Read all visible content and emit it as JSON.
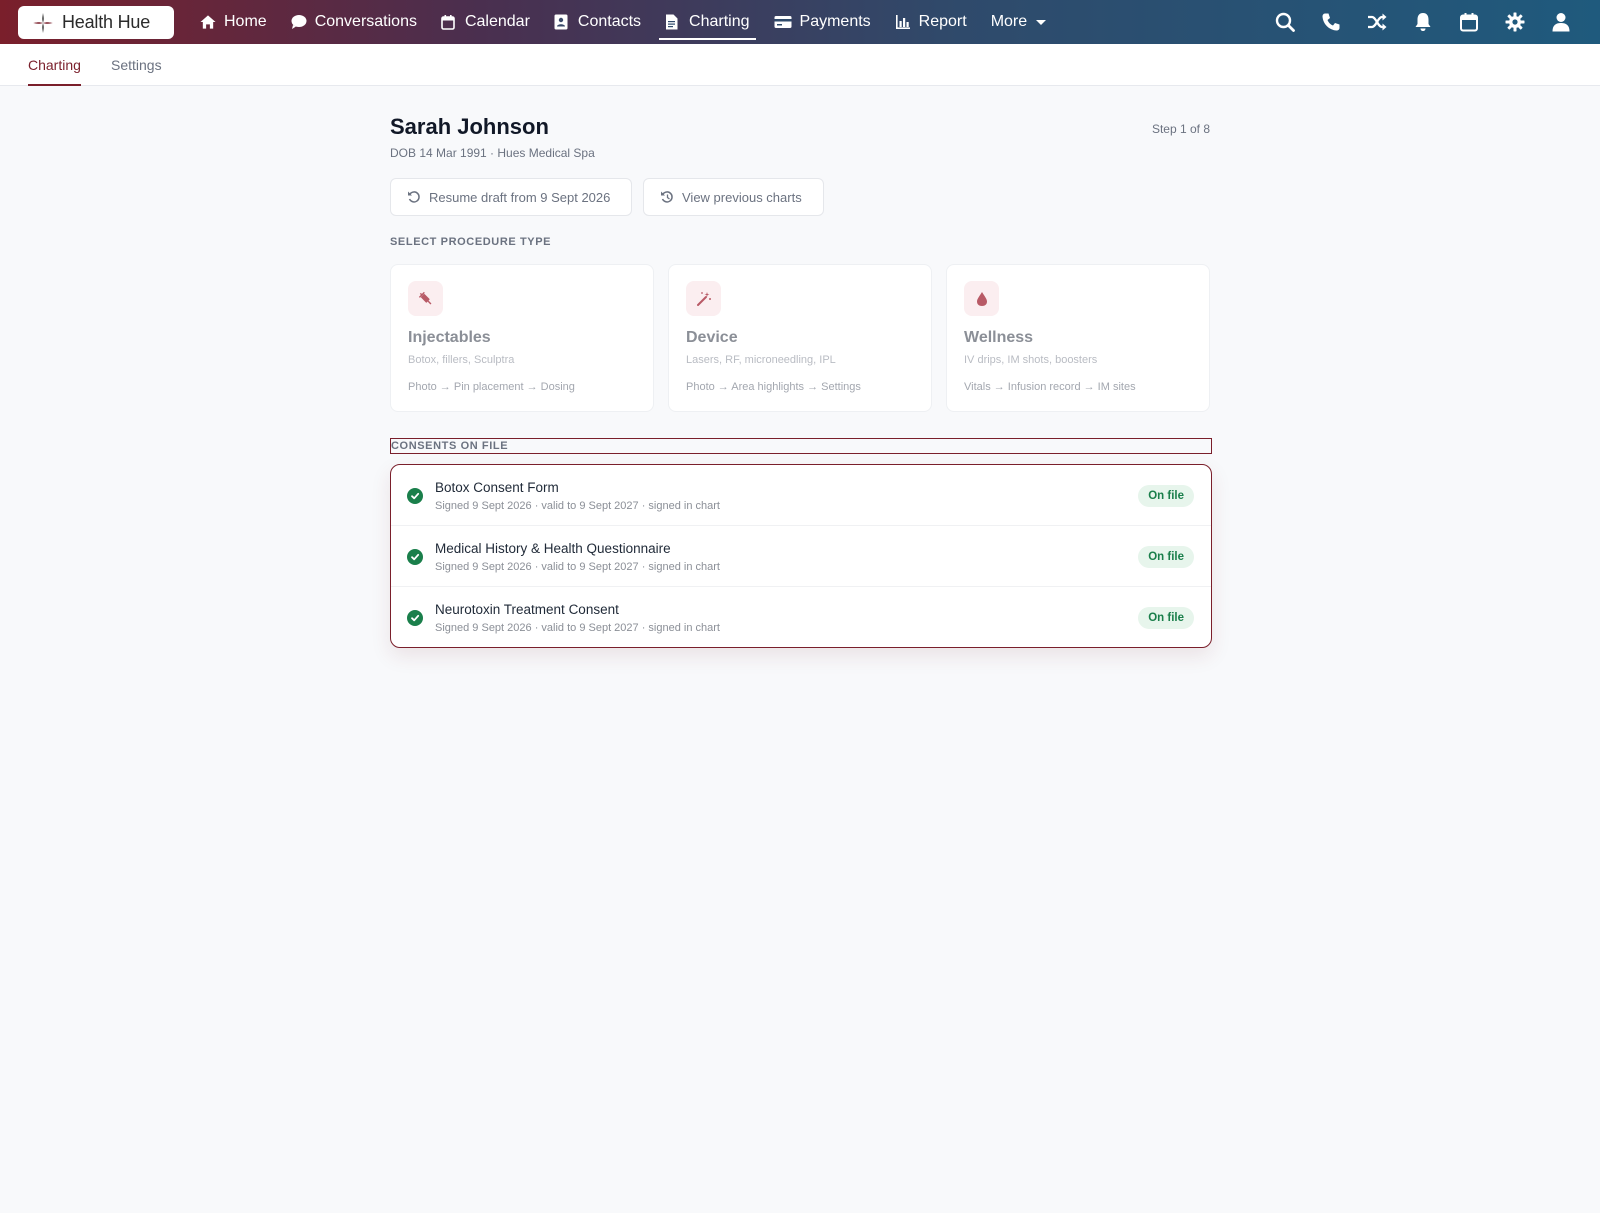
{
  "brand": {
    "name": "Health Hue"
  },
  "nav": {
    "items": [
      {
        "label": "Home",
        "icon": "home-icon"
      },
      {
        "label": "Conversations",
        "icon": "chat-bubble-icon"
      },
      {
        "label": "Calendar",
        "icon": "calendar-icon"
      },
      {
        "label": "Contacts",
        "icon": "contact-card-icon"
      },
      {
        "label": "Charting",
        "icon": "document-icon",
        "active": true
      },
      {
        "label": "Payments",
        "icon": "credit-card-icon"
      },
      {
        "label": "Report",
        "icon": "bar-chart-icon"
      },
      {
        "label": "More",
        "icon": "caret-down-icon"
      }
    ],
    "right_icons": [
      "search-icon",
      "phone-icon",
      "shuffle-icon",
      "bell-icon",
      "calendar-icon",
      "gear-icon",
      "user-icon"
    ]
  },
  "subnav": {
    "tabs": [
      {
        "label": "Charting",
        "active": true
      },
      {
        "label": "Settings"
      }
    ]
  },
  "patient": {
    "name": "Sarah Johnson",
    "subtitle": "DOB 14 Mar 1991 · Hues Medical Spa"
  },
  "step": "Step 1 of 8",
  "actions": {
    "resume": "Resume draft from 9 Sept 2026",
    "previous": "View previous charts"
  },
  "procedure": {
    "label": "SELECT PROCEDURE TYPE",
    "cards": [
      {
        "title": "Injectables",
        "desc": "Botox, fillers, Sculptra",
        "flow": "Photo → Pin placement → Dosing",
        "icon": "syringe-icon"
      },
      {
        "title": "Device",
        "desc": "Lasers, RF, microneedling, IPL",
        "flow": "Photo → Area highlights → Settings",
        "icon": "wand-icon"
      },
      {
        "title": "Wellness",
        "desc": "IV drips, IM shots, boosters",
        "flow": "Vitals → Infusion record → IM sites",
        "icon": "droplet-icon"
      }
    ]
  },
  "consents": {
    "label": "CONSENTS ON FILE",
    "items": [
      {
        "title": "Botox Consent Form",
        "meta": "Signed 9 Sept 2026 · valid to 9 Sept 2027 · signed in chart",
        "status": "On file"
      },
      {
        "title": "Medical History & Health Questionnaire",
        "meta": "Signed 9 Sept 2026 · valid to 9 Sept 2027 · signed in chart",
        "status": "On file"
      },
      {
        "title": "Neurotoxin Treatment Consent",
        "meta": "Signed 9 Sept 2026 · valid to 9 Sept 2027 · signed in chart",
        "status": "On file"
      }
    ]
  },
  "colors": {
    "accent": "#7a1f2b",
    "success": "#1a7f4b",
    "success_bg": "#e7f5ec"
  }
}
